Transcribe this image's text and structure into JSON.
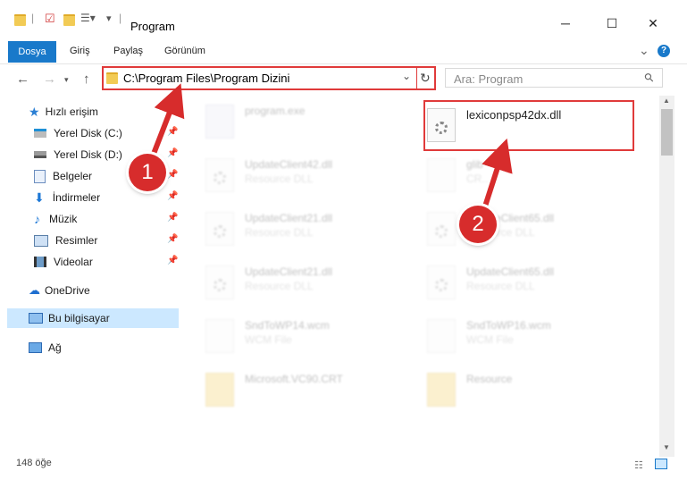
{
  "window": {
    "title": "Program",
    "minimize": "─",
    "maximize": "☐",
    "close": "✕"
  },
  "ribbon": {
    "tabs": [
      "Dosya",
      "Giriş",
      "Paylaş",
      "Görünüm"
    ],
    "help": "?",
    "collapse": "⌄"
  },
  "address": {
    "path": "C:\\Program Files\\Program Dizini",
    "refresh": "↻",
    "dropdown": "⌄"
  },
  "search": {
    "placeholder": "Ara: Program",
    "icon": "⚲"
  },
  "nav": {
    "quick_access": "Hızlı erişim",
    "items": [
      "Yerel Disk (C:)",
      "Yerel Disk (D:)",
      "Belgeler",
      "İndirmeler",
      "Müzik",
      "Resimler",
      "Videolar"
    ],
    "onedrive": "OneDrive",
    "this_pc": "Bu bilgisayar",
    "network": "Ağ"
  },
  "files": [
    {
      "name": "program.exe",
      "type": ""
    },
    {
      "name": "lexiconpsp42dx.dll",
      "type": ""
    },
    {
      "name": "UpdateClient42.dll",
      "type": "Resource DLL"
    },
    {
      "name": "glib",
      "type": "CR...e"
    },
    {
      "name": "UpdateClient21.dll",
      "type": "Resource DLL"
    },
    {
      "name": "UpdateClient65.dll",
      "type": "Resource DLL"
    },
    {
      "name": "UpdateClient21.dll",
      "type": "Resource DLL"
    },
    {
      "name": "UpdateClient65.dll",
      "type": "Resource DLL"
    },
    {
      "name": "SndToWP14.wcm",
      "type": "WCM File"
    },
    {
      "name": "SndToWP16.wcm",
      "type": "WCM File"
    },
    {
      "name": "Microsoft.VC90.CRT",
      "type": ""
    },
    {
      "name": "Resource",
      "type": ""
    }
  ],
  "status": {
    "count": "148 öğe"
  },
  "annotations": {
    "step1": "1",
    "step2": "2"
  },
  "colors": {
    "accent": "#1979ca",
    "annotation": "#d72c2c",
    "selection": "#cce8ff"
  }
}
